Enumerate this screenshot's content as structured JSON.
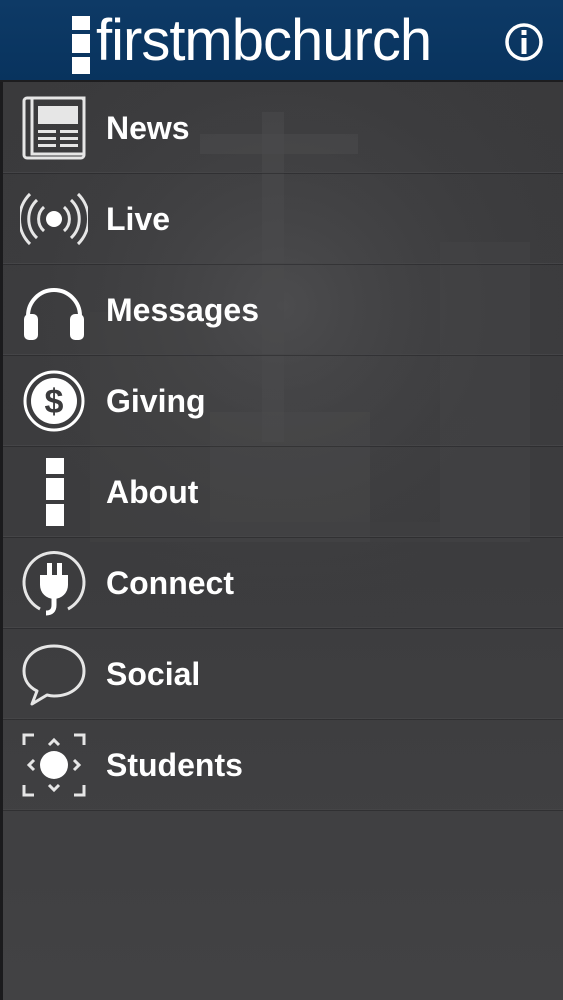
{
  "header": {
    "title": "firstmbchurch",
    "info_icon": "info-circle-icon",
    "background_color": "#0b3860"
  },
  "menu": {
    "items": [
      {
        "label": "News",
        "icon": "newspaper-icon"
      },
      {
        "label": "Live",
        "icon": "broadcast-icon"
      },
      {
        "label": "Messages",
        "icon": "headphones-icon"
      },
      {
        "label": "Giving",
        "icon": "dollar-coin-icon"
      },
      {
        "label": "About",
        "icon": "logo-bars-icon"
      },
      {
        "label": "Connect",
        "icon": "plug-icon"
      },
      {
        "label": "Social",
        "icon": "speech-bubble-icon"
      },
      {
        "label": "Students",
        "icon": "students-icon"
      }
    ]
  },
  "colors": {
    "menu_background": "#3b3b3d",
    "text": "#ffffff"
  }
}
